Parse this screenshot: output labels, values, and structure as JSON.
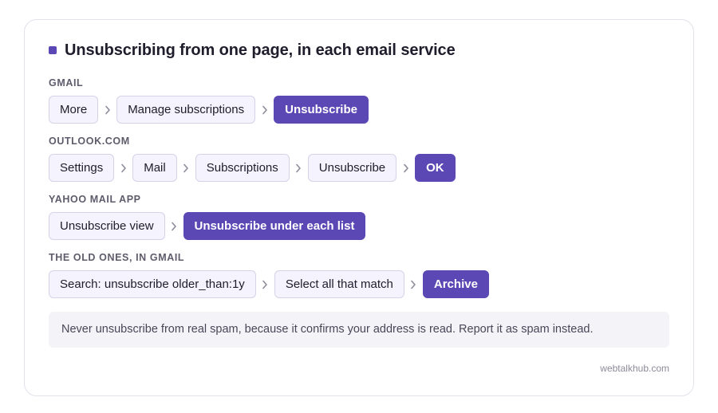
{
  "title": "Unsubscribing from one page, in each email service",
  "sections": [
    {
      "label": "GMAIL",
      "steps": [
        "More",
        "Manage subscriptions",
        "Unsubscribe"
      ]
    },
    {
      "label": "OUTLOOK.COM",
      "steps": [
        "Settings",
        "Mail",
        "Subscriptions",
        "Unsubscribe",
        "OK"
      ]
    },
    {
      "label": "YAHOO MAIL APP",
      "steps": [
        "Unsubscribe view",
        "Unsubscribe under each list"
      ]
    },
    {
      "label": "THE OLD ONES, IN GMAIL",
      "steps": [
        "Search: unsubscribe older_than:1y",
        "Select all that match",
        "Archive"
      ]
    }
  ],
  "note": "Never unsubscribe from real spam, because it confirms your address is read. Report it as spam instead.",
  "footer": "webtalkhub.com",
  "colors": {
    "accent": "#5b48b5",
    "chip_bg": "#f5f3fd",
    "chip_border": "#d6d2e8",
    "note_bg": "#f4f3f8"
  },
  "icons": {
    "title_marker": "square-bullet-icon",
    "separator": "chevron-right-icon"
  }
}
